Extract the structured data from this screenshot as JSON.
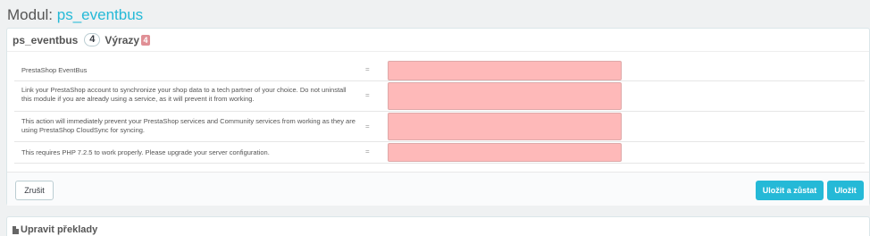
{
  "page": {
    "title_prefix": "Modul:",
    "module_name": "ps_eventbus"
  },
  "panel": {
    "heading": "ps_eventbus",
    "count": "4",
    "expressions_label": "Výrazy",
    "expressions_badge": "4"
  },
  "rows": [
    {
      "text": "PrestaShop EventBus",
      "arrow": "=",
      "value": ""
    },
    {
      "text": "Link your PrestaShop account to synchronize your shop data to a tech partner of your choice. Do not uninstall this module if you are already using a service, as it will prevent it from working.",
      "arrow": "=",
      "value": ""
    },
    {
      "text": "This action will immediately prevent your PrestaShop services and Community services from working as they are using PrestaShop CloudSync for syncing.",
      "arrow": "=",
      "value": ""
    },
    {
      "text": "This requires PHP 7.2.5 to work properly. Please upgrade your server configuration.",
      "arrow": "=",
      "value": ""
    }
  ],
  "footer": {
    "cancel_label": "Zrušit",
    "save_stay_label": "Uložit a zůstat",
    "save_label": "Uložit"
  },
  "panel2": {
    "icon": "document-icon",
    "heading": "Upravit překlady"
  },
  "colors": {
    "accent": "#25b9d7",
    "missing_field": "#feb9b9",
    "badge_red": "#e08f95"
  }
}
